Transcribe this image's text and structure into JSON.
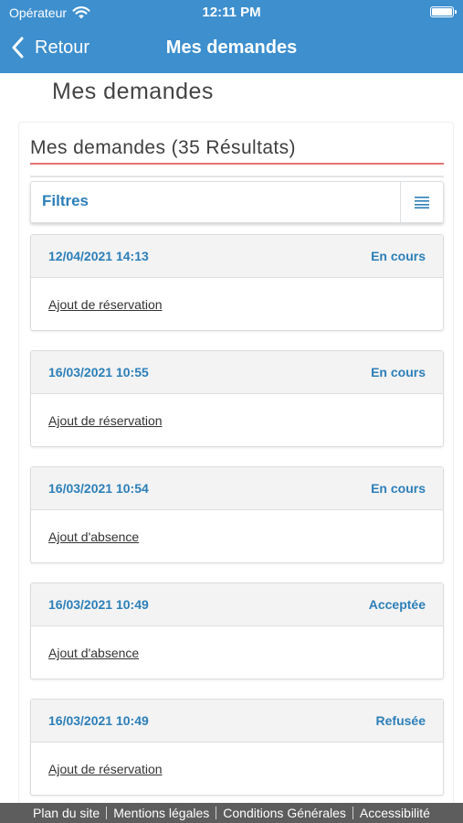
{
  "status_bar": {
    "carrier": "Opérateur",
    "time": "12:11 PM"
  },
  "nav": {
    "back_label": "Retour",
    "title": "Mes demandes"
  },
  "page_title": "Mes demandes",
  "results_title": "Mes demandes (35 Résultats)",
  "filters_label": "Filtres",
  "requests": [
    {
      "date": "12/04/2021 14:13",
      "status": "En cours",
      "type": "Ajout de réservation"
    },
    {
      "date": "16/03/2021 10:55",
      "status": "En cours",
      "type": "Ajout de réservation"
    },
    {
      "date": "16/03/2021 10:54",
      "status": "En cours",
      "type": "Ajout d'absence"
    },
    {
      "date": "16/03/2021 10:49",
      "status": "Acceptée",
      "type": "Ajout d'absence"
    },
    {
      "date": "16/03/2021 10:49",
      "status": "Refusée",
      "type": "Ajout de réservation"
    }
  ],
  "footer": {
    "links": [
      "Plan du site",
      "Mentions légales",
      "Conditions Générales",
      "Accessibilité"
    ]
  },
  "colors": {
    "accent": "#3d8fce",
    "link_blue": "#2c7fb8",
    "underline_red": "#e57373",
    "footer_bg": "#5d5d5d"
  },
  "icons": {
    "wifi": "wifi-icon",
    "battery": "battery-icon",
    "back": "chevron-left-icon",
    "filter_toggle": "list-icon"
  }
}
